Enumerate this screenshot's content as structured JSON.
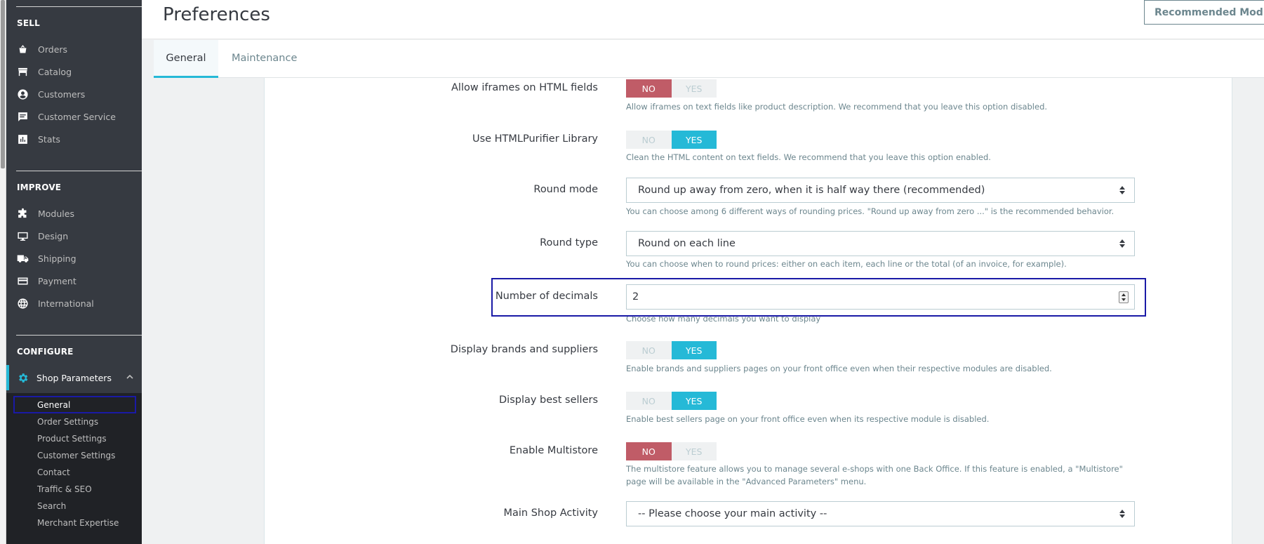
{
  "sidebar": {
    "sell_title": "SELL",
    "sell_items": [
      {
        "label": "Orders",
        "icon": "basket-icon"
      },
      {
        "label": "Catalog",
        "icon": "store-icon"
      },
      {
        "label": "Customers",
        "icon": "account-circle-icon"
      },
      {
        "label": "Customer Service",
        "icon": "chat-icon"
      },
      {
        "label": "Stats",
        "icon": "bar-chart-icon"
      }
    ],
    "improve_title": "IMPROVE",
    "improve_items": [
      {
        "label": "Modules",
        "icon": "puzzle-icon"
      },
      {
        "label": "Design",
        "icon": "desktop-icon"
      },
      {
        "label": "Shipping",
        "icon": "truck-icon"
      },
      {
        "label": "Payment",
        "icon": "credit-card-icon"
      },
      {
        "label": "International",
        "icon": "globe-icon"
      }
    ],
    "configure_title": "CONFIGURE",
    "active_item": {
      "label": "Shop Parameters",
      "icon": "gear-icon"
    },
    "sub_items": [
      "General",
      "Order Settings",
      "Product Settings",
      "Customer Settings",
      "Contact",
      "Traffic & SEO",
      "Search",
      "Merchant Expertise"
    ]
  },
  "header": {
    "title": "Preferences",
    "recommended_label": "Recommended Modules"
  },
  "tabs": [
    {
      "label": "General",
      "active": true
    },
    {
      "label": "Maintenance",
      "active": false
    }
  ],
  "form": {
    "iframes": {
      "label": "Allow iframes on HTML fields",
      "no": "NO",
      "yes": "YES",
      "value": "NO",
      "help": "Allow iframes on text fields like product description. We recommend that you leave this option disabled."
    },
    "purifier": {
      "label": "Use HTMLPurifier Library",
      "no": "NO",
      "yes": "YES",
      "value": "YES",
      "help": "Clean the HTML content on text fields. We recommend that you leave this option enabled."
    },
    "round_mode": {
      "label": "Round mode",
      "value": "Round up away from zero, when it is half way there (recommended)",
      "help": "You can choose among 6 different ways of rounding prices. \"Round up away from zero ...\" is the recommended behavior."
    },
    "round_type": {
      "label": "Round type",
      "value": "Round on each line",
      "help": "You can choose when to round prices: either on each item, each line or the total (of an invoice, for example)."
    },
    "decimals": {
      "label": "Number of decimals",
      "value": "2",
      "help": "Choose how many decimals you want to display"
    },
    "brands": {
      "label": "Display brands and suppliers",
      "no": "NO",
      "yes": "YES",
      "value": "YES",
      "help": "Enable brands and suppliers pages on your front office even when their respective modules are disabled."
    },
    "best_sellers": {
      "label": "Display best sellers",
      "no": "NO",
      "yes": "YES",
      "value": "YES",
      "help": "Enable best sellers page on your front office even when its respective module is disabled."
    },
    "multistore": {
      "label": "Enable Multistore",
      "no": "NO",
      "yes": "YES",
      "value": "NO",
      "help": "The multistore feature allows you to manage several e-shops with one Back Office. If this feature is enabled, a \"Multistore\" page will be available in the \"Advanced Parameters\" menu."
    },
    "activity": {
      "label": "Main Shop Activity",
      "value": "-- Please choose your main activity --"
    }
  },
  "colors": {
    "accent": "#25b9d7",
    "no_active": "#c05c67",
    "sidebar_bg": "#363a41",
    "focus_outline": "#1a1aa6"
  }
}
